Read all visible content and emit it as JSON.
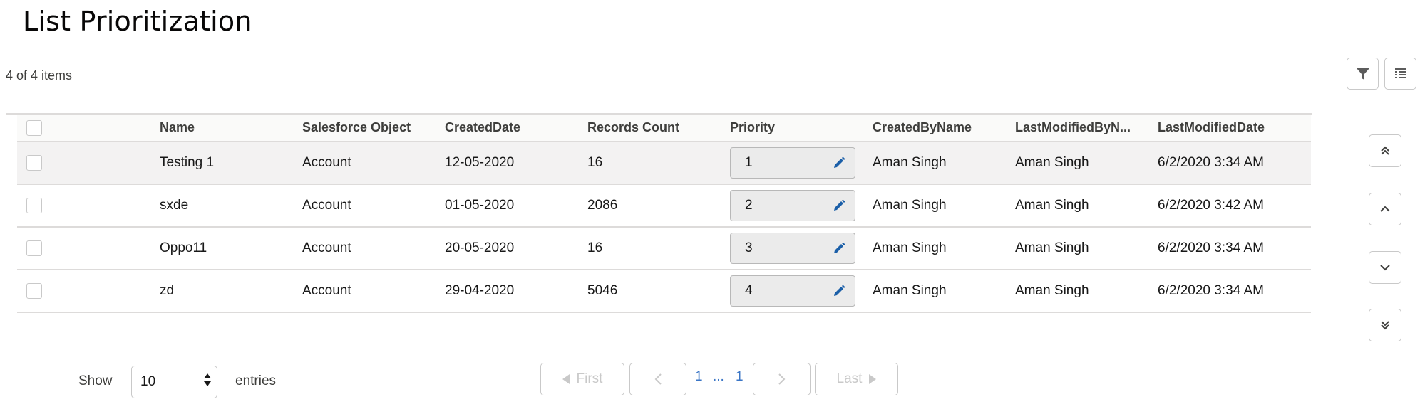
{
  "page": {
    "title": "List Prioritization",
    "item_count": "4 of 4 items"
  },
  "table": {
    "columns": [
      "Name",
      "Salesforce Object",
      "CreatedDate",
      "Records Count",
      "Priority",
      "CreatedByName",
      "LastModifiedByN...",
      "LastModifiedDate"
    ],
    "rows": [
      {
        "name": "Testing 1",
        "object": "Account",
        "created_date": "12-05-2020",
        "records_count": "16",
        "priority": "1",
        "created_by": "Aman Singh",
        "last_modified_by": "Aman Singh",
        "last_modified_date": "6/2/2020 3:34 AM"
      },
      {
        "name": "sxde",
        "object": "Account",
        "created_date": "01-05-2020",
        "records_count": "2086",
        "priority": "2",
        "created_by": "Aman Singh",
        "last_modified_by": "Aman Singh",
        "last_modified_date": "6/2/2020 3:42 AM"
      },
      {
        "name": "Oppo11",
        "object": "Account",
        "created_date": "20-05-2020",
        "records_count": "16",
        "priority": "3",
        "created_by": "Aman Singh",
        "last_modified_by": "Aman Singh",
        "last_modified_date": "6/2/2020 3:34 AM"
      },
      {
        "name": "zd",
        "object": "Account",
        "created_date": "29-04-2020",
        "records_count": "5046",
        "priority": "4",
        "created_by": "Aman Singh",
        "last_modified_by": "Aman Singh",
        "last_modified_date": "6/2/2020 3:34 AM"
      }
    ]
  },
  "toolbar": {
    "filter_icon": "filter-icon",
    "columns_icon": "column-list-icon"
  },
  "reorder": {
    "top_icon": "double-chevron-up-icon",
    "up_icon": "chevron-up-icon",
    "down_icon": "chevron-down-icon",
    "bottom_icon": "double-chevron-down-icon"
  },
  "footer": {
    "show_label": "Show",
    "page_size": "10",
    "entries_label": "entries",
    "pagination": {
      "first": "First",
      "last": "Last",
      "current_page": "1",
      "ellipsis": "...",
      "total_pages": "1"
    }
  },
  "colors": {
    "accent": "#3b76c6",
    "icon_blue": "#1b5fa8",
    "border": "#dddbda"
  }
}
